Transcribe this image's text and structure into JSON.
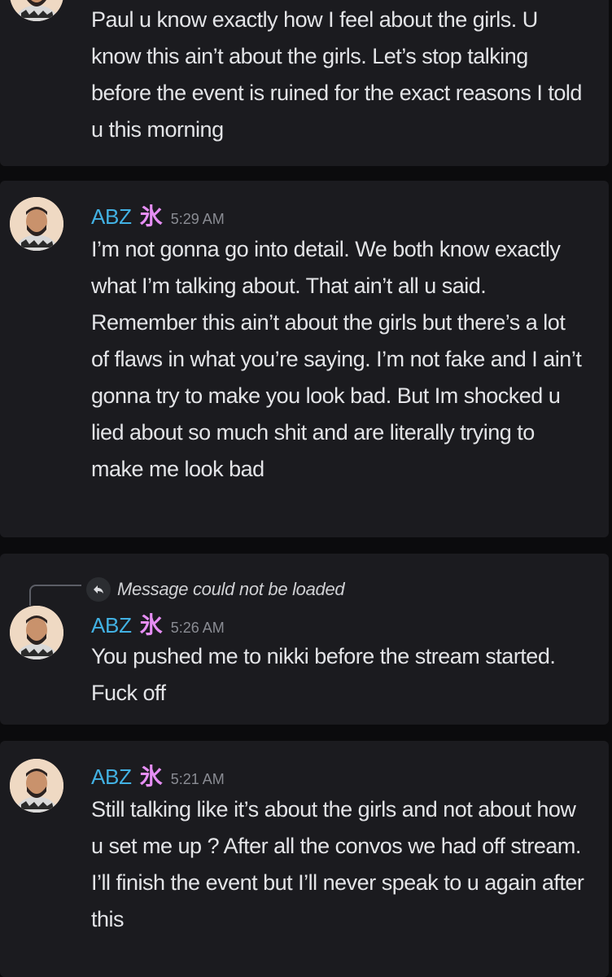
{
  "messages": [
    {
      "username": "",
      "timestamp": "",
      "text": "Paul u know exactly how I feel about the girls. U know this ain’t about the girls. Let’s stop talking before the event is ruined for the exact reasons I told u this morning"
    },
    {
      "username": "ABZ",
      "role_glyph": "氷",
      "timestamp": "5:29 AM",
      "text": "I’m not gonna go into detail. We both know exactly what I’m talking about. That ain’t all u said. Remember this ain’t about the girls but there’s a lot of flaws in what you’re saying. I’m not fake and I ain’t gonna try to make you look bad. But Im shocked u lied about so much shit and are literally trying to make me look bad"
    },
    {
      "username": "ABZ",
      "role_glyph": "氷",
      "timestamp": "5:26 AM",
      "reply_text": "Message could not be loaded",
      "reply_icon": "reply-arrow-icon",
      "text": "You pushed me to nikki before the stream started. Fuck off"
    },
    {
      "username": "ABZ",
      "role_glyph": "氷",
      "timestamp": "5:21 AM",
      "text": "Still talking like it’s about the girls and not about how u set me up ? After all the convos we had off stream. I’ll finish the event but I’ll never speak to u again after this"
    }
  ],
  "colors": {
    "background": "#0b0b0d",
    "card": "#1b1b1f",
    "username": "#42b1e3",
    "role_glyph": "#e68ef4",
    "timestamp": "#8a8c93",
    "message_text": "#e3e4e7"
  }
}
